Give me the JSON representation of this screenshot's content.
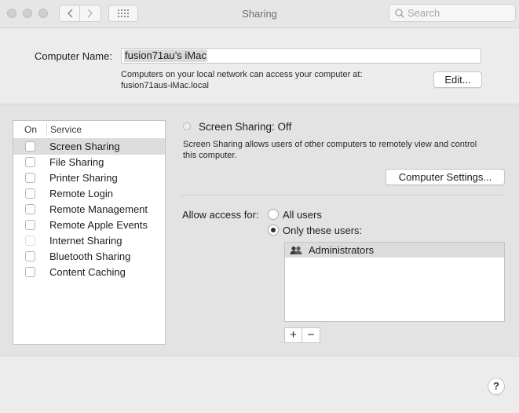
{
  "window": {
    "title": "Sharing",
    "search_placeholder": "Search"
  },
  "computer_name": {
    "label": "Computer Name:",
    "value": "fusion71au’s iMac",
    "info_line1": "Computers on your local network can access your computer at:",
    "info_line2": "fusion71aus-iMac.local",
    "edit_button": "Edit..."
  },
  "services": {
    "col_on": "On",
    "col_service": "Service",
    "items": [
      {
        "label": "Screen Sharing",
        "checked": false,
        "selected": true
      },
      {
        "label": "File Sharing",
        "checked": false
      },
      {
        "label": "Printer Sharing",
        "checked": false
      },
      {
        "label": "Remote Login",
        "checked": false
      },
      {
        "label": "Remote Management",
        "checked": false
      },
      {
        "label": "Remote Apple Events",
        "checked": false
      },
      {
        "label": "Internet Sharing",
        "checked": false,
        "disabled": true
      },
      {
        "label": "Bluetooth Sharing",
        "checked": false
      },
      {
        "label": "Content Caching",
        "checked": false
      }
    ]
  },
  "detail": {
    "status": "Screen Sharing: Off",
    "description_line1": "Screen Sharing allows users of other computers to remotely view and control",
    "description_line2": "this computer.",
    "settings_button": "Computer Settings...",
    "allow_label": "Allow access for:",
    "option_all": "All users",
    "option_only": "Only these users:",
    "selected_option": "Only these users:",
    "users": [
      "Administrators"
    ],
    "add_button": "+",
    "remove_button": "−"
  },
  "help_button": "?"
}
